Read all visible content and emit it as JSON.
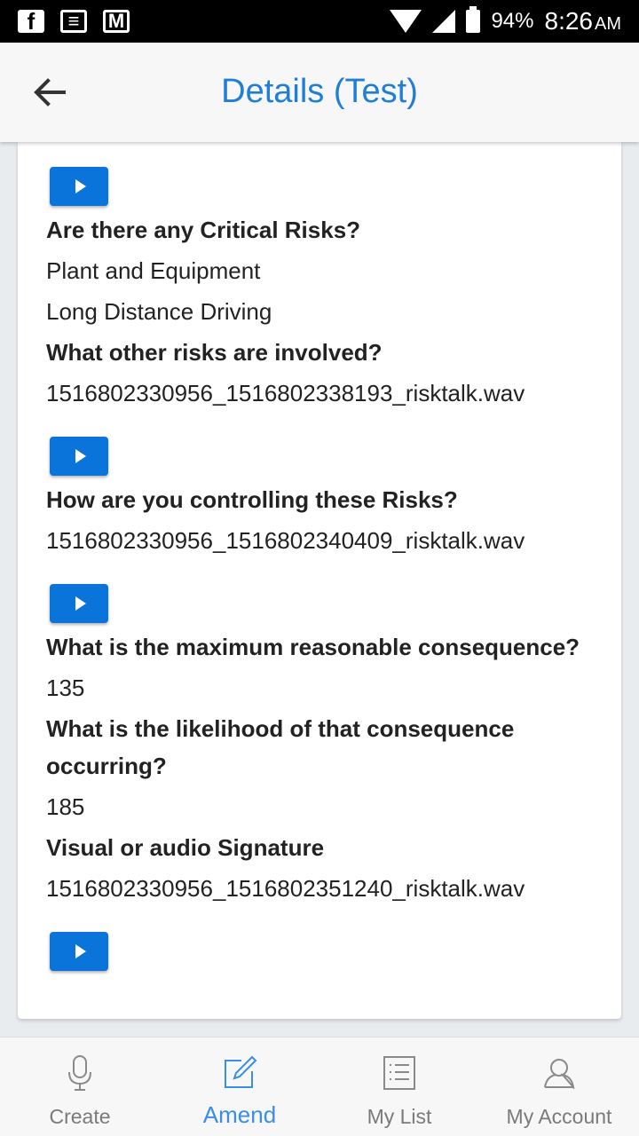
{
  "status_bar": {
    "battery": "94%",
    "time": "8:26",
    "ampm": "AM",
    "left_icons": [
      "facebook-icon",
      "news-icon",
      "gmail-icon"
    ]
  },
  "header": {
    "title": "Details (Test)"
  },
  "content": {
    "q1": "Are there any Critical Risks?",
    "q1_answers": [
      "Plant and Equipment",
      "Long Distance Driving"
    ],
    "q2": "What other risks are involved?",
    "q2_answer": "1516802330956_1516802338193_risktalk.wav",
    "q3": "How are you controlling these Risks?",
    "q3_answer": "1516802330956_1516802340409_risktalk.wav",
    "q4": "What is the maximum reasonable consequence?",
    "q4_answer": "135",
    "q5": "What is the likelihood of that consequence occurring?",
    "q5_answer": "185",
    "q6": "Visual or audio Signature",
    "q6_answer": "1516802330956_1516802351240_risktalk.wav"
  },
  "bottom_nav": {
    "items": [
      {
        "label": "Create",
        "icon": "microphone-icon"
      },
      {
        "label": "Amend",
        "icon": "edit-icon"
      },
      {
        "label": "My List",
        "icon": "list-icon"
      },
      {
        "label": "My Account",
        "icon": "user-icon"
      }
    ],
    "active": "Amend"
  },
  "colors": {
    "accent": "#1e7ed8",
    "play_button": "#0a74da",
    "background": "#e9ecef"
  }
}
